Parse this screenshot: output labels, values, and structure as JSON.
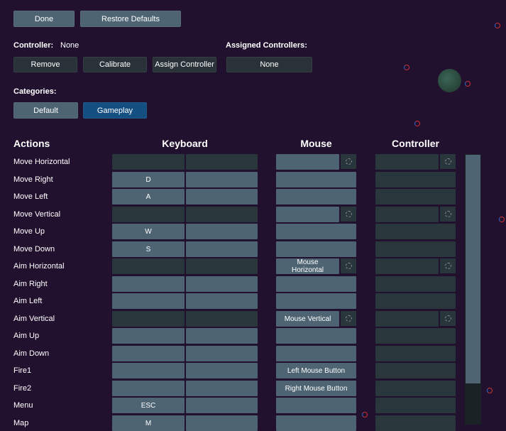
{
  "toolbar": {
    "done": "Done",
    "restore_defaults": "Restore Defaults"
  },
  "controller": {
    "label": "Controller:",
    "value": "None",
    "remove": "Remove",
    "calibrate": "Calibrate",
    "assign": "Assign Controller"
  },
  "assigned": {
    "label": "Assigned Controllers:",
    "value": "None"
  },
  "categories": {
    "label": "Categories:",
    "items": [
      {
        "label": "Default",
        "active": false
      },
      {
        "label": "Gameplay",
        "active": true
      }
    ]
  },
  "headers": {
    "actions": "Actions",
    "keyboard": "Keyboard",
    "mouse": "Mouse",
    "controller": "Controller"
  },
  "rows": [
    {
      "action": "Move Horizontal",
      "kb1": "",
      "kb2": "",
      "mouse": "",
      "ctrl": ""
    },
    {
      "action": "Move Right",
      "kb1": "D",
      "kb2": "",
      "mouse": "",
      "ctrl": ""
    },
    {
      "action": "Move Left",
      "kb1": "A",
      "kb2": "",
      "mouse": "",
      "ctrl": ""
    },
    {
      "action": "Move Vertical",
      "kb1": "",
      "kb2": "",
      "mouse": "",
      "ctrl": ""
    },
    {
      "action": "Move Up",
      "kb1": "W",
      "kb2": "",
      "mouse": "",
      "ctrl": ""
    },
    {
      "action": "Move Down",
      "kb1": "S",
      "kb2": "",
      "mouse": "",
      "ctrl": ""
    },
    {
      "action": "Aim Horizontal",
      "kb1": "",
      "kb2": "",
      "mouse": "Mouse\nHorizontal",
      "ctrl": ""
    },
    {
      "action": "Aim Right",
      "kb1": "",
      "kb2": "",
      "mouse": "",
      "ctrl": ""
    },
    {
      "action": "Aim Left",
      "kb1": "",
      "kb2": "",
      "mouse": "",
      "ctrl": ""
    },
    {
      "action": "Aim Vertical",
      "kb1": "",
      "kb2": "",
      "mouse": "Mouse Vertical",
      "ctrl": ""
    },
    {
      "action": "Aim Up",
      "kb1": "",
      "kb2": "",
      "mouse": "",
      "ctrl": ""
    },
    {
      "action": "Aim Down",
      "kb1": "",
      "kb2": "",
      "mouse": "",
      "ctrl": ""
    },
    {
      "action": "Fire1",
      "kb1": "",
      "kb2": "",
      "mouse": "Left Mouse Button",
      "ctrl": ""
    },
    {
      "action": "Fire2",
      "kb1": "",
      "kb2": "",
      "mouse": "Right Mouse Button",
      "ctrl": ""
    },
    {
      "action": "Menu",
      "kb1": "ESC",
      "kb2": "",
      "mouse": "",
      "ctrl": ""
    },
    {
      "action": "Map",
      "kb1": "M",
      "kb2": "",
      "mouse": "",
      "ctrl": ""
    }
  ]
}
